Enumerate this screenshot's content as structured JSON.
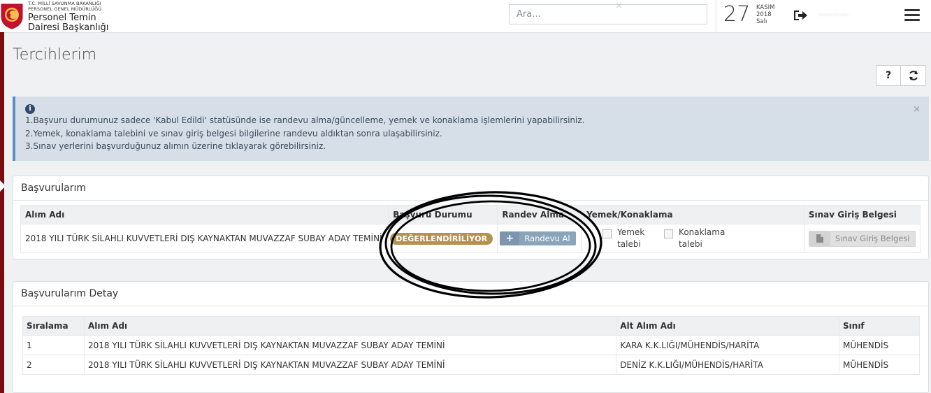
{
  "header": {
    "org_line1": "T.C. MİLLİ SAVUNMA BAKANLIĞI",
    "org_line2": "PERSONEL GENEL MÜDÜRLÜĞÜ",
    "org_line3": "Personel Temin",
    "org_line4": "Dairesi Başkanlığı",
    "search_placeholder": "Ara...",
    "date_day": "27",
    "date_month": "KASIM",
    "date_year": "2018",
    "date_weekday": "Salı",
    "user_name": "————"
  },
  "page": {
    "title": "Tercihlerim",
    "help_label": "?",
    "refresh_label": "⟳"
  },
  "alert": {
    "icon": "i",
    "lines": [
      "1.Başvuru durumunuz sadece 'Kabul Edildi' statüsünde ise randevu alma/güncelleme, yemek ve konaklama işlemlerini yapabilirsiniz.",
      "2.Yemek, konaklama talebini ve sınav giriş belgesi bilgilerine randevu aldıktan sonra ulaşabilirsiniz.",
      "3.Sınav yerlerini başvurduğunuz alımın üzerine tıklayarak görebilirsiniz."
    ],
    "close": "×"
  },
  "basvurularim": {
    "title": "Başvurularım",
    "columns": [
      "Alım Adı",
      "Başvuru Durumu",
      "Randev Alma",
      "Yemek/Konaklama",
      "Sınav Giriş Belgesi"
    ],
    "row": {
      "alim_adi": "2018 YILI TÜRK SİLAHLI KUVVETLERİ DIŞ KAYNAKTAN MUVAZZAF SUBAY ADAY TEMİNİ",
      "durum": "DEĞERLENDİRİLİYOR",
      "randevu_button": "Randevu Al",
      "yemek_line1": "Yemek",
      "yemek_line2": "talebi",
      "konaklama_line1": "Konaklama",
      "konaklama_line2": "talebi",
      "sinav_button": "Sınav Giriş Belgesi"
    }
  },
  "detay": {
    "title": "Başvurularım Detay",
    "columns": [
      "Sıralama",
      "Alım Adı",
      "Alt Alım Adı",
      "Sınıf"
    ],
    "rows": [
      [
        "1",
        "2018 YILI TÜRK SİLAHLI KUVVETLERİ DIŞ KAYNAKTAN MUVAZZAF SUBAY ADAY TEMİNİ",
        "KARA K.K.LIĞI/MÜHENDİS/HARİTA",
        "MÜHENDİS"
      ],
      [
        "2",
        "2018 YILI TÜRK SİLAHLI KUVVETLERİ DIŞ KAYNAKTAN MUVAZZAF SUBAY ADAY TEMİNİ",
        "DENİZ K.K.LIĞI/MÜHENDİS/HARİTA",
        "MÜHENDİS"
      ]
    ]
  },
  "colors": {
    "brand_red": "#c8102e",
    "badge": "#b5924c",
    "alert_bg": "#d6dee8"
  }
}
